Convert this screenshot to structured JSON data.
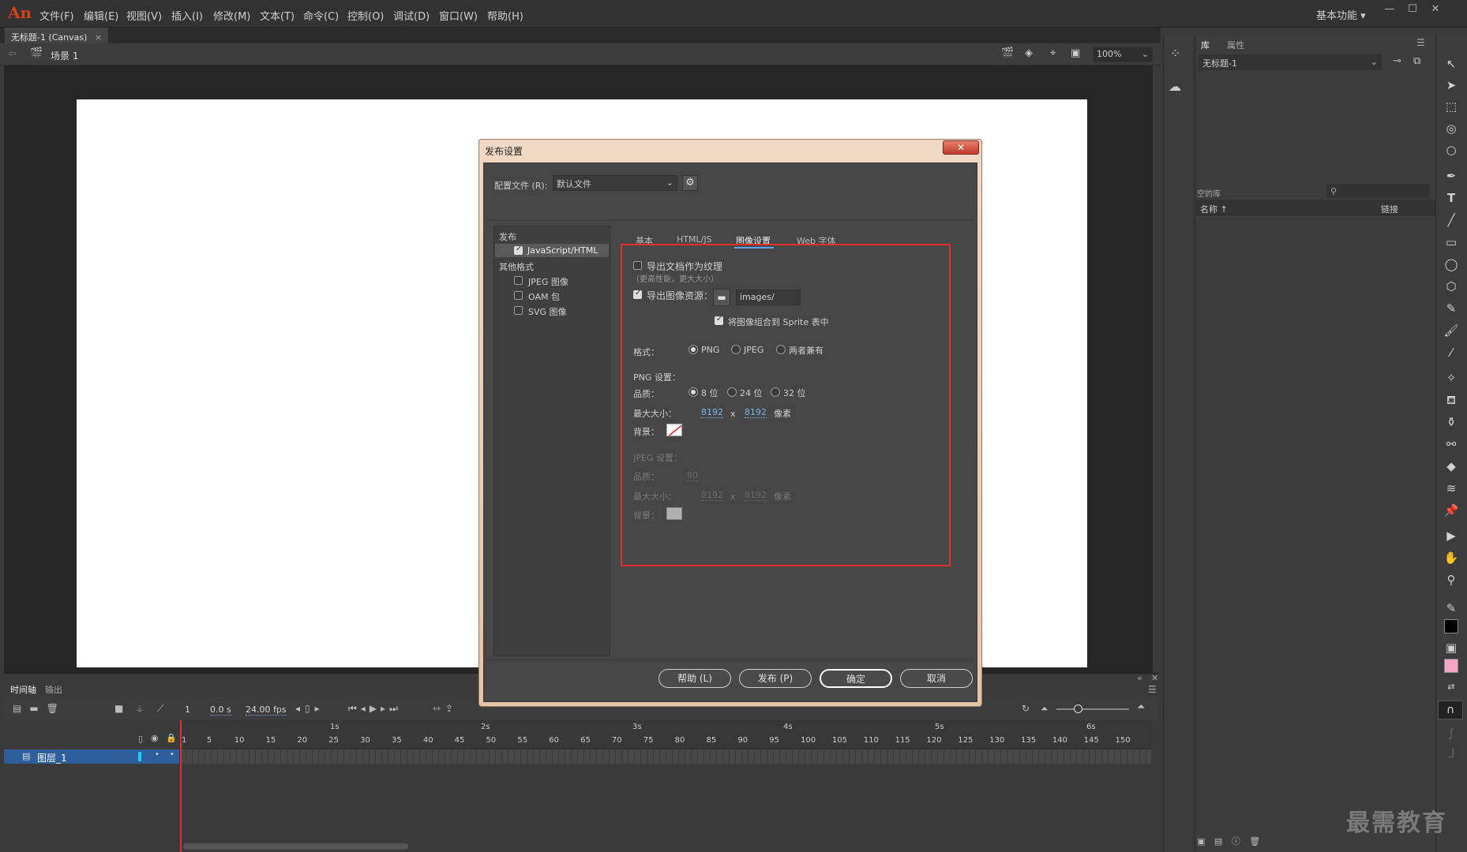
{
  "app": {
    "logo": "An",
    "workspace": "基本功能"
  },
  "menu": [
    "文件(F)",
    "编辑(E)",
    "视图(V)",
    "插入(I)",
    "修改(M)",
    "文本(T)",
    "命令(C)",
    "控制(O)",
    "调试(D)",
    "窗口(W)",
    "帮助(H)"
  ],
  "doc_tab": {
    "title": "无标题-1 (Canvas)",
    "close": "×"
  },
  "editbar": {
    "scene": "场景 1",
    "zoom": "100%"
  },
  "library": {
    "tab_lib": "库",
    "tab_props": "属性",
    "doc_select": "无标题-1",
    "lib_label": "空的库",
    "col_name": "名称 ↑",
    "col_link": "链接"
  },
  "timeline": {
    "tab_timeline": "时间轴",
    "tab_output": "输出",
    "frame": "1",
    "time": "0.0 s",
    "fps": "24.00 fps",
    "layer_name": "图层_1",
    "seconds": [
      "1s",
      "2s",
      "3s",
      "4s",
      "5s",
      "6s"
    ],
    "frame_labels": [
      "1",
      "5",
      "10",
      "15",
      "20",
      "25",
      "30",
      "35",
      "40",
      "45",
      "50",
      "55",
      "60",
      "65",
      "70",
      "75",
      "80",
      "85",
      "90",
      "95",
      "100",
      "105",
      "110",
      "115",
      "120",
      "125",
      "130",
      "135",
      "140",
      "145",
      "150"
    ]
  },
  "dialog": {
    "title": "发布设置",
    "close": "✕",
    "profile_label": "配置文件 (R):",
    "profile_value": "默认文件",
    "left": {
      "publish": "发布",
      "js_html": "JavaScript/HTML",
      "other": "其他格式",
      "jpeg": "JPEG 图像",
      "oam": "OAM 包",
      "svg": "SVG 图像"
    },
    "tabs": [
      "基本",
      "HTML/JS",
      "图像设置",
      "Web 字体"
    ],
    "export_texture": "导出文档作为纹理",
    "export_texture_note": "（更高性能，更大大小）",
    "export_images": "导出图像资源：",
    "images_path": "images/",
    "combine_sprite": "将图像组合到 Sprite 表中",
    "format_label": "格式：",
    "fmt_png": "PNG",
    "fmt_jpeg": "JPEG",
    "fmt_both": "两者兼有",
    "png_settings": "PNG 设置：",
    "quality_label": "品质：",
    "q8": "8 位",
    "q24": "24 位",
    "q32": "32 位",
    "maxsize_label": "最大大小：",
    "png_w": "8192",
    "png_h": "8192",
    "x": "x",
    "pixels": "像素",
    "bg_label": "背景：",
    "jpeg_settings": "JPEG 设置：",
    "jpeg_quality": "80",
    "jpeg_w": "8192",
    "jpeg_h": "8192",
    "btn_help": "帮助 (L)",
    "btn_publish": "发布 (P)",
    "btn_ok": "确定",
    "btn_cancel": "取消"
  },
  "watermark": "最需教育"
}
